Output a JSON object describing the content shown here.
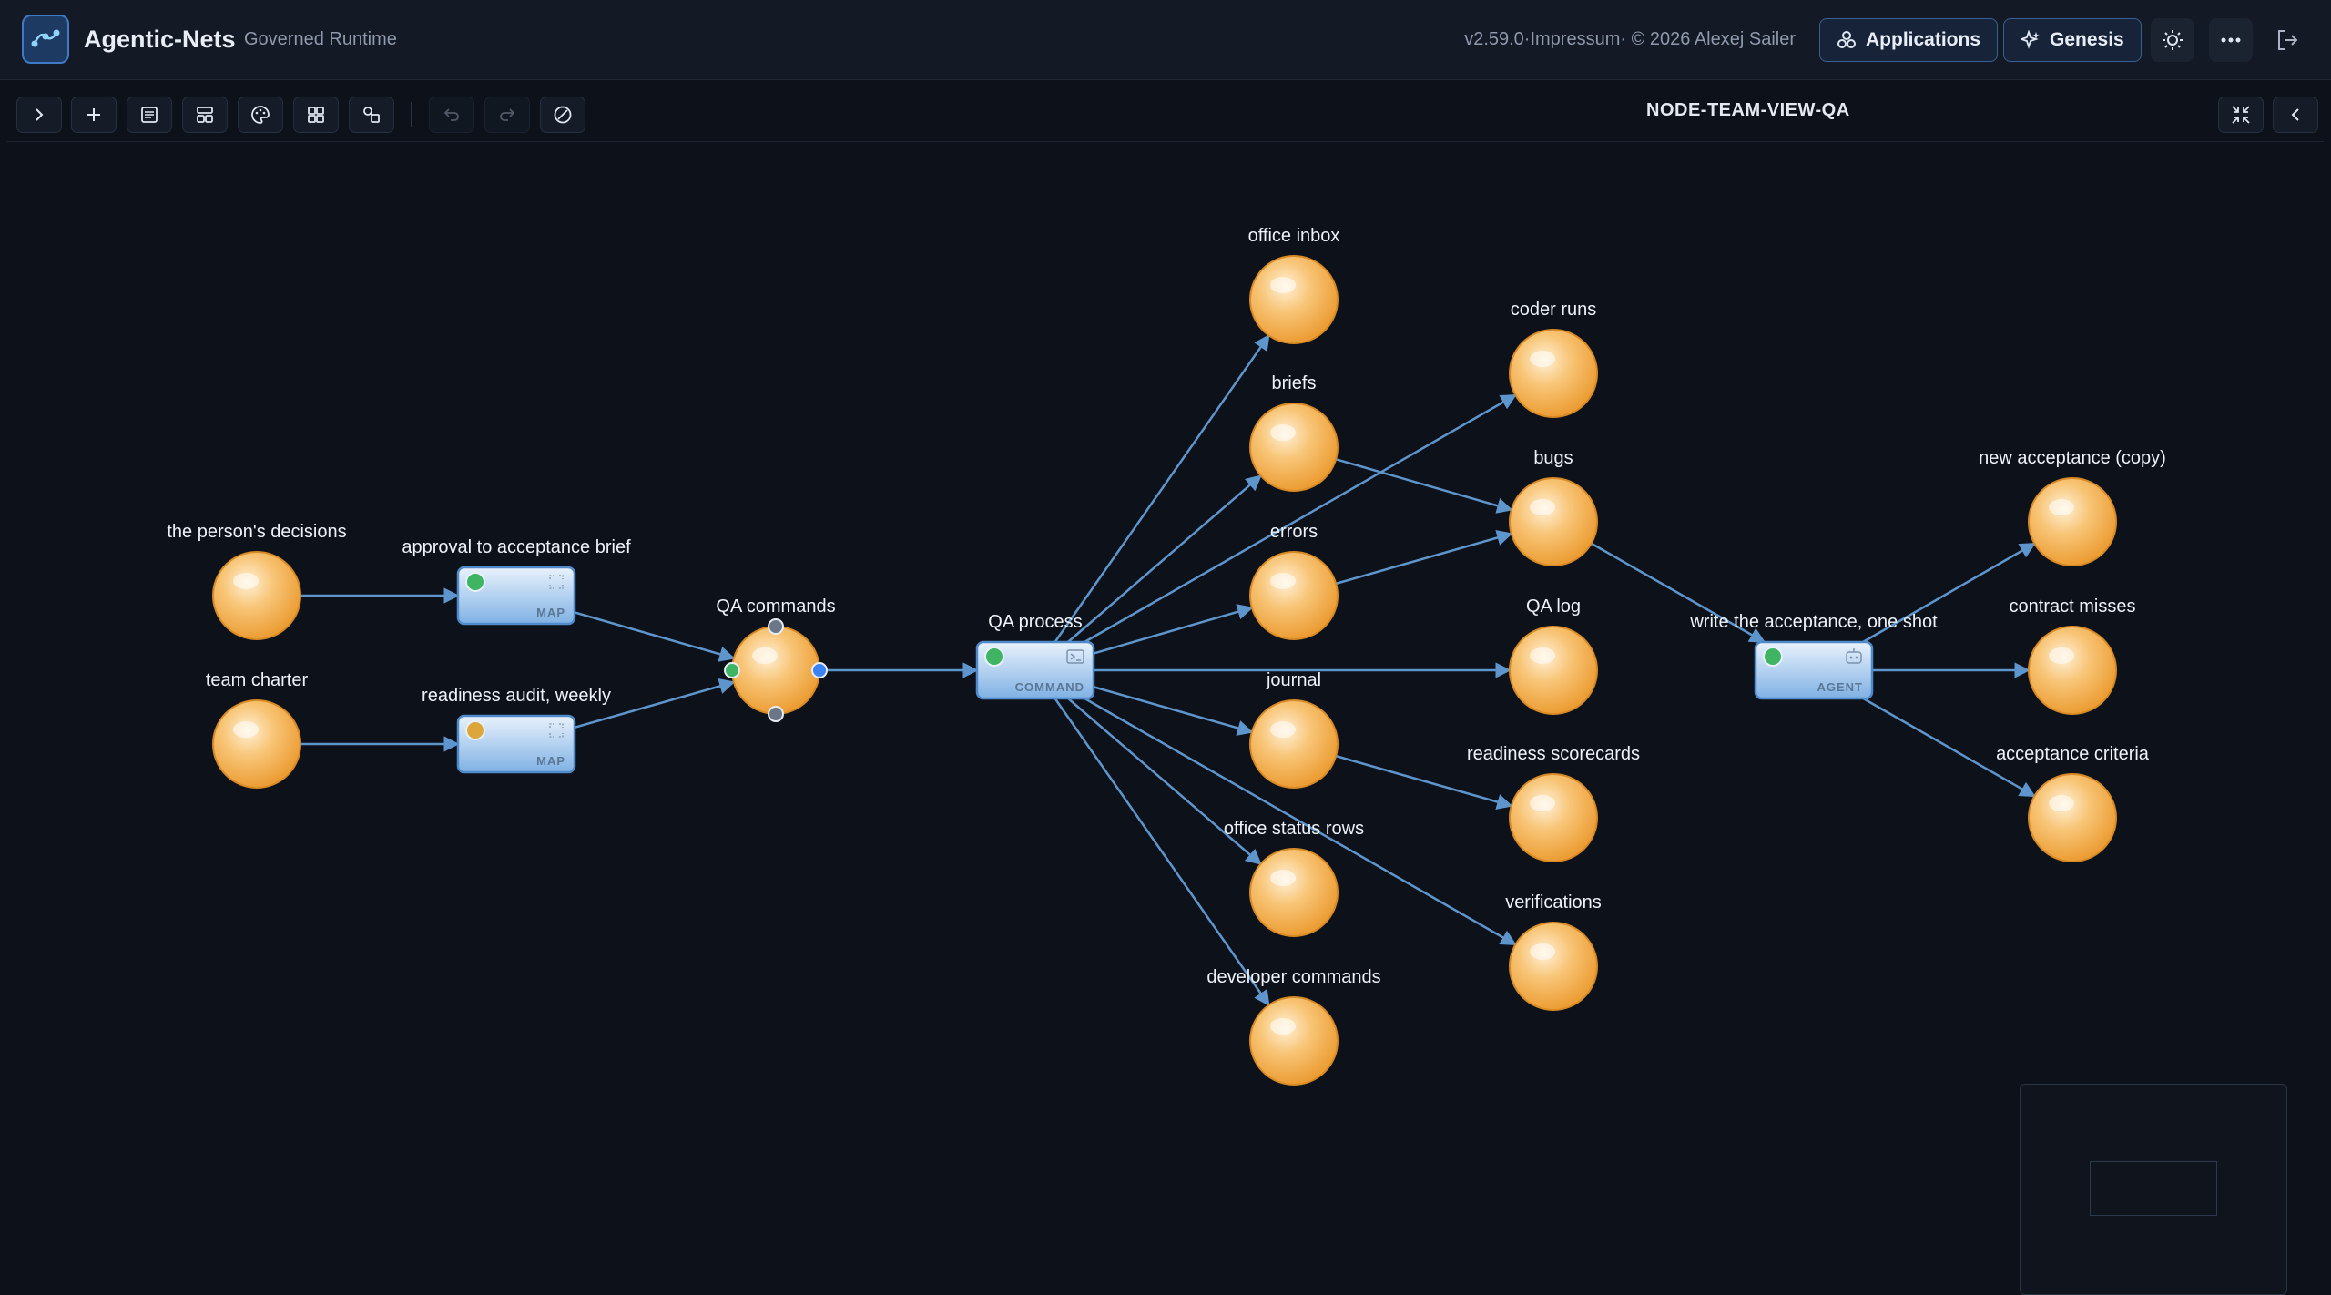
{
  "header": {
    "app_title": "Agentic-Nets",
    "app_subtitle": "Governed Runtime",
    "version": "v2.59.0·Impressum· © 2026 Alexej Sailer",
    "applications_label": "Applications",
    "genesis_label": "Genesis"
  },
  "toolbar": {
    "view_title": "NODE-TEAM-VIEW-QA",
    "buttons": [
      "expand-sidebar",
      "add",
      "list",
      "layout",
      "palette",
      "grid",
      "shapes",
      "undo",
      "redo",
      "clear"
    ]
  },
  "colors": {
    "accent": "#3f7ac4",
    "arc": "#5e95cc",
    "place": "#f5b253",
    "status_green": "#3fb564",
    "status_amber": "#dca63a",
    "handle_blue": "#3b82f6"
  },
  "net": {
    "places": [
      {
        "id": "decisions",
        "label": "the person's decisions"
      },
      {
        "id": "charter",
        "label": "team charter"
      },
      {
        "id": "qa_commands",
        "label": "QA commands"
      },
      {
        "id": "office_inbox",
        "label": "office inbox"
      },
      {
        "id": "briefs",
        "label": "briefs"
      },
      {
        "id": "errors",
        "label": "errors"
      },
      {
        "id": "journal",
        "label": "journal"
      },
      {
        "id": "office_status",
        "label": "office status rows"
      },
      {
        "id": "dev_commands",
        "label": "developer commands"
      },
      {
        "id": "coder_runs",
        "label": "coder runs"
      },
      {
        "id": "bugs",
        "label": "bugs"
      },
      {
        "id": "qa_log",
        "label": "QA log"
      },
      {
        "id": "readiness_scorecards",
        "label": "readiness scorecards"
      },
      {
        "id": "verifications",
        "label": "verifications"
      },
      {
        "id": "new_acceptance",
        "label": "new acceptance (copy)"
      },
      {
        "id": "contract_misses",
        "label": "contract misses"
      },
      {
        "id": "acceptance_criteria",
        "label": "acceptance criteria"
      }
    ],
    "transitions": [
      {
        "id": "approval",
        "label": "approval to acceptance brief",
        "kind": "MAP",
        "status": "green",
        "icon": "expand-icon"
      },
      {
        "id": "readiness",
        "label": "readiness audit, weekly",
        "kind": "MAP",
        "status": "amber",
        "icon": "expand-icon"
      },
      {
        "id": "qa_process",
        "label": "QA process",
        "kind": "COMMAND",
        "status": "green",
        "icon": "terminal-icon"
      },
      {
        "id": "write_acceptance",
        "label": "write the acceptance, one shot",
        "kind": "AGENT",
        "status": "green",
        "icon": "robot-icon"
      }
    ],
    "arcs": [
      [
        "decisions",
        "approval"
      ],
      [
        "charter",
        "readiness"
      ],
      [
        "approval",
        "qa_commands"
      ],
      [
        "readiness",
        "qa_commands"
      ],
      [
        "qa_commands",
        "qa_process"
      ],
      [
        "qa_process",
        "office_inbox"
      ],
      [
        "qa_process",
        "briefs"
      ],
      [
        "qa_process",
        "coder_runs"
      ],
      [
        "qa_process",
        "errors"
      ],
      [
        "qa_process",
        "qa_log"
      ],
      [
        "qa_process",
        "journal"
      ],
      [
        "qa_process",
        "office_status"
      ],
      [
        "qa_process",
        "dev_commands"
      ],
      [
        "qa_process",
        "verifications"
      ],
      [
        "briefs",
        "bugs"
      ],
      [
        "errors",
        "bugs"
      ],
      [
        "journal",
        "readiness_scorecards"
      ],
      [
        "bugs",
        "write_acceptance"
      ],
      [
        "write_acceptance",
        "new_acceptance"
      ],
      [
        "write_acceptance",
        "contract_misses"
      ],
      [
        "write_acceptance",
        "acceptance_criteria"
      ]
    ]
  }
}
